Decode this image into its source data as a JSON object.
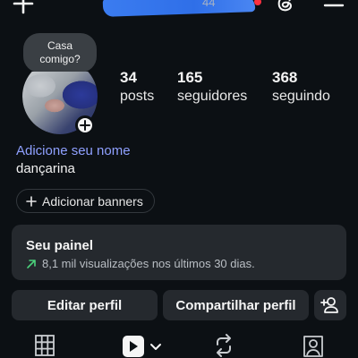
{
  "header": {
    "username_suffix": "44",
    "icons": [
      "plus-icon",
      "threads-icon",
      "menu-icon"
    ],
    "notification_color": "#ff3040"
  },
  "note": {
    "text_line1": "Casa",
    "text_line2": "comigo?"
  },
  "stats": [
    {
      "value": "34",
      "label": "posts"
    },
    {
      "value": "165",
      "label": "seguidores"
    },
    {
      "value": "368",
      "label": "seguindo"
    }
  ],
  "profile": {
    "add_name_label": "Adicione seu nome",
    "bio": "dançarina",
    "add_banners_label": "Adicionar banners"
  },
  "panel": {
    "title": "Seu painel",
    "subtitle": "8,1 mil visualizações nos últimos 30 dias."
  },
  "actions": {
    "edit_profile": "Editar perfil",
    "share_profile": "Compartilhar perfil"
  },
  "tabs": [
    "grid-icon",
    "reels-icon",
    "reposts-icon",
    "tagged-icon"
  ],
  "colors": {
    "background": "#0c1014",
    "accent_link": "#8fa0ff",
    "button_bg": "#25292e",
    "trend_green": "#4bd17b"
  }
}
